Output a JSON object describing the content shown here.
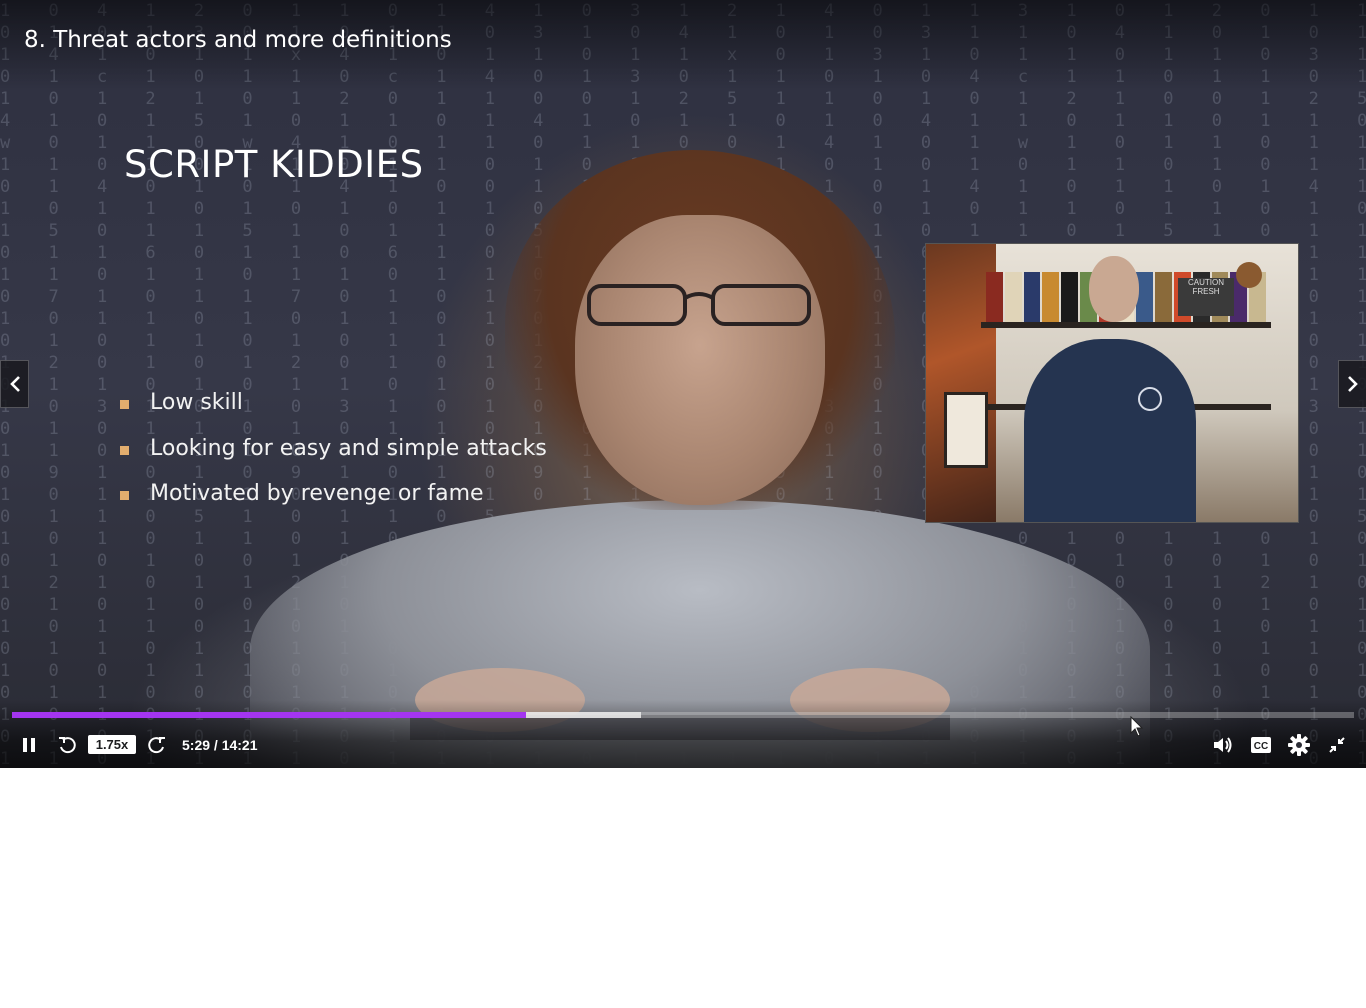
{
  "lecture": {
    "title": "8. Threat actors and more definitions"
  },
  "slide": {
    "heading": "SCRIPT KIDDIES",
    "bullets": [
      "Low skill",
      "Looking for easy and simple attacks",
      "Motivated by revenge or fame"
    ]
  },
  "pip": {
    "sign_text": "CAUTION FRESH"
  },
  "navigation": {
    "prev_icon": "chevron-left-icon",
    "next_icon": "chevron-right-icon"
  },
  "player": {
    "progress": {
      "played_fraction": 0.383,
      "buffered_fraction": 0.469
    },
    "playback_rate": "1.75x",
    "time_display": "5:29 / 14:21",
    "icons": {
      "play_pause": "pause-icon",
      "rewind": "rewind-icon",
      "forward": "forward-icon",
      "volume": "volume-icon",
      "captions": "captions-icon",
      "settings": "gear-icon",
      "exit_fullscreen": "exit-fullscreen-icon"
    },
    "colors": {
      "accent": "#a435f0",
      "speed_bg": "#ffffff"
    }
  }
}
